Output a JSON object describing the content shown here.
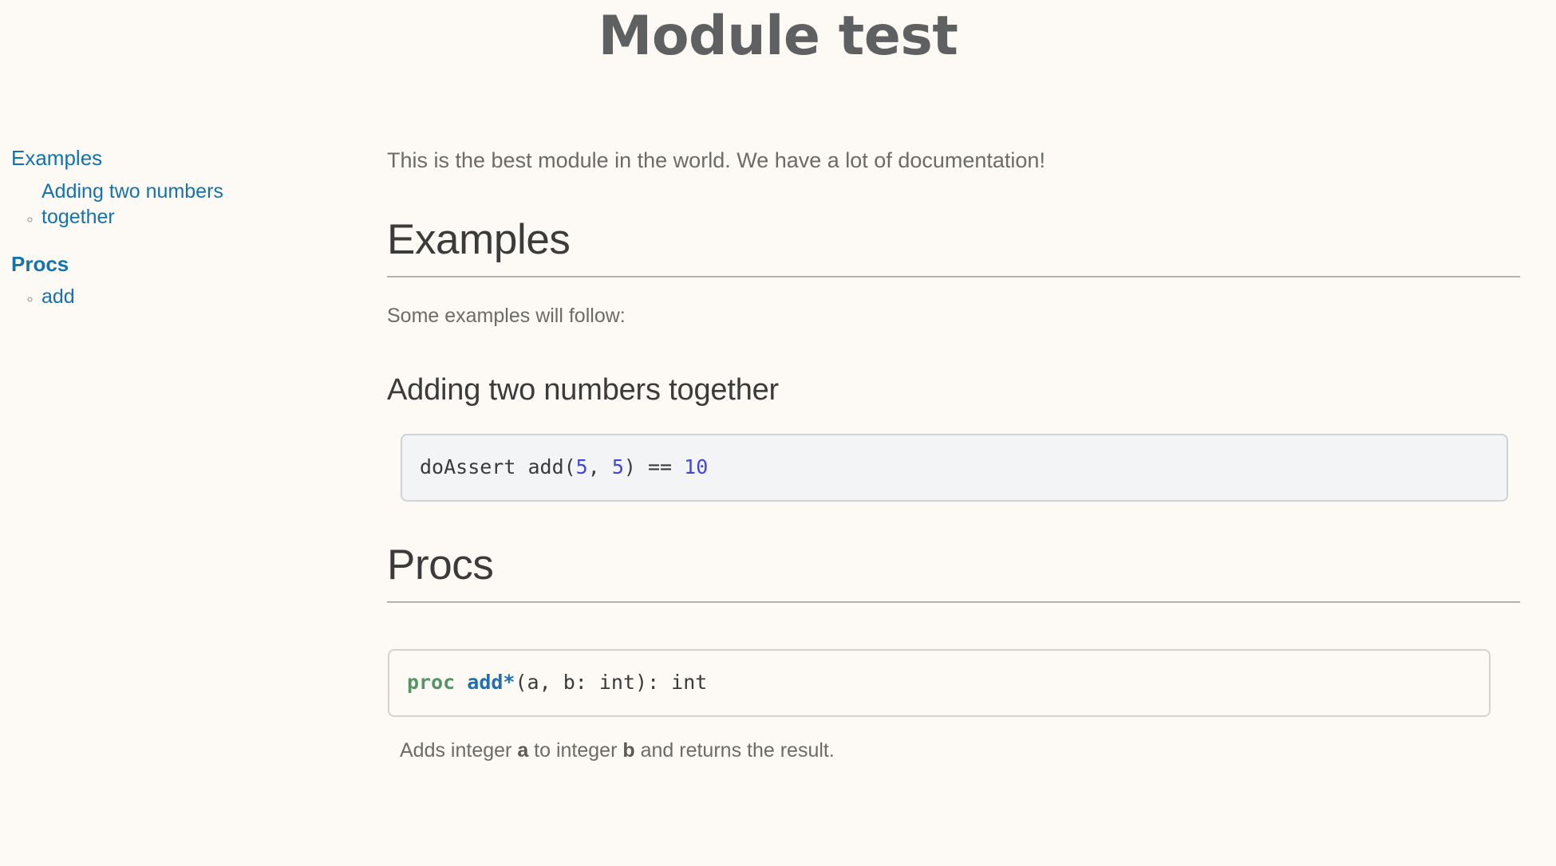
{
  "page": {
    "title": "Module test"
  },
  "sidebar": {
    "sections": [
      {
        "label": "Examples",
        "bold": false,
        "items": [
          {
            "label": "Adding two numbers together"
          }
        ]
      },
      {
        "label": "Procs",
        "bold": true,
        "items": [
          {
            "label": "add"
          }
        ]
      }
    ]
  },
  "content": {
    "intro": "This is the best module in the world. We have a lot of documentation!",
    "examples_heading": "Examples",
    "examples_note": "Some examples will follow:",
    "example": {
      "heading": "Adding two numbers together",
      "code": {
        "pre": "doAssert add(",
        "num1": "5",
        "mid": ", ",
        "num2": "5",
        "post": ") == ",
        "num3": "10"
      }
    },
    "procs_heading": "Procs",
    "proc": {
      "signature": {
        "keyword": "proc",
        "space": " ",
        "name": "add*",
        "rest": "(a, b: int): int"
      },
      "description": {
        "part1": "Adds integer ",
        "param_a": "a",
        "part2": " to integer ",
        "param_b": "b",
        "part3": " and returns the result."
      }
    }
  },
  "colors": {
    "background": "#fdf9f5",
    "link": "#1473ad",
    "heading": "#3b3b3b",
    "body_text": "#6e6a67",
    "rule": "#b3b0ad",
    "example_background": "#f2f4f5",
    "code_border": "#d5d3d1",
    "number_literal": "#4646d6",
    "keyword_green": "#539565",
    "function_blue": "#1f6fb5"
  }
}
